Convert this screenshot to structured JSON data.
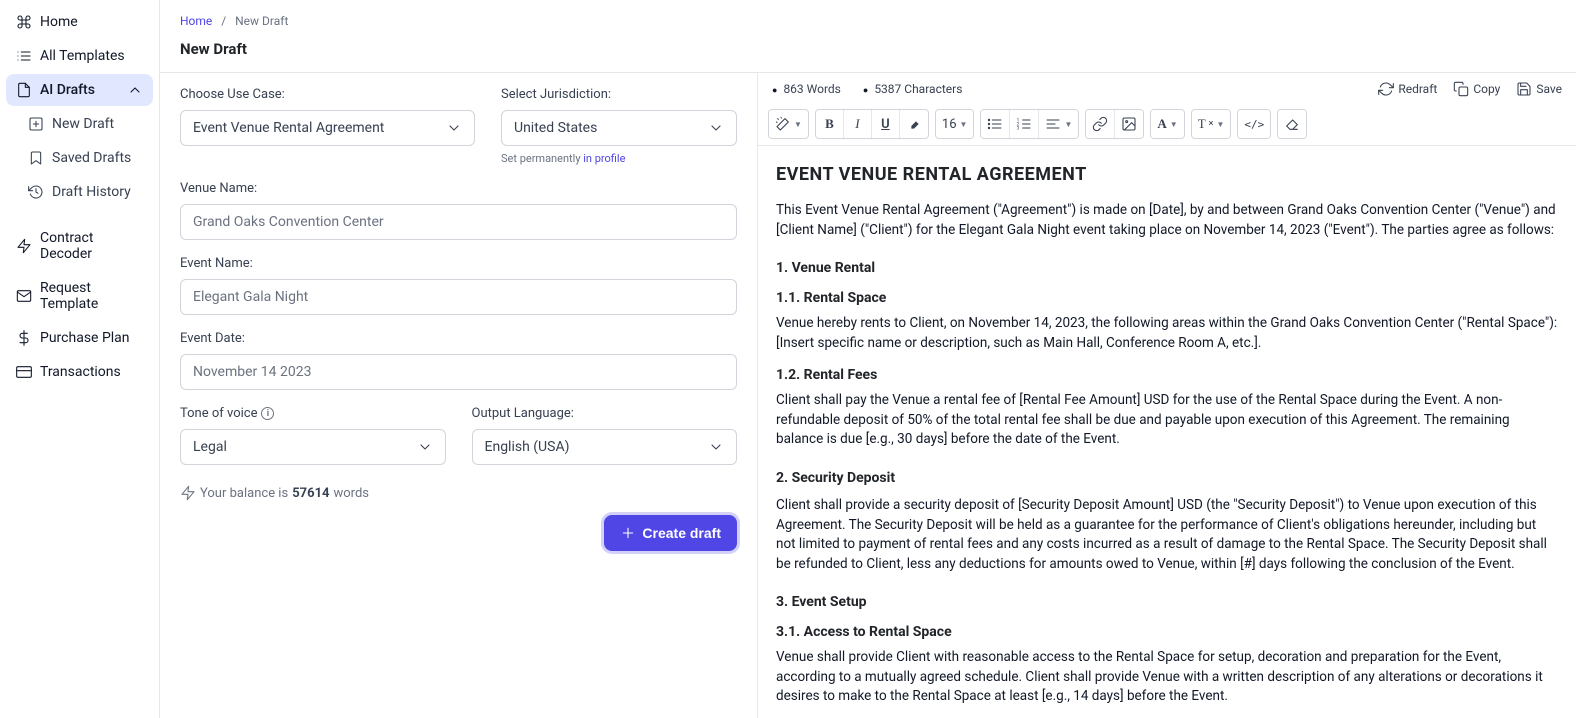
{
  "sidebar": {
    "home": "Home",
    "all_templates": "All Templates",
    "ai_drafts": "AI Drafts",
    "new_draft": "New Draft",
    "saved_drafts": "Saved Drafts",
    "draft_history": "Draft History",
    "contract_decoder": "Contract Decoder",
    "request_template": "Request Template",
    "purchase_plan": "Purchase Plan",
    "transactions": "Transactions"
  },
  "breadcrumb": {
    "home": "Home",
    "sep": "/",
    "current": "New Draft"
  },
  "page_title": "New Draft",
  "form": {
    "use_case_label": "Choose Use Case:",
    "use_case_value": "Event Venue Rental Agreement",
    "jurisdiction_label": "Select Jurisdiction:",
    "jurisdiction_value": "United States",
    "jurisdiction_hint_pre": "Set permanently ",
    "jurisdiction_hint_link": "in profile",
    "venue_label": "Venue Name:",
    "venue_value": "Grand Oaks Convention Center",
    "event_name_label": "Event Name:",
    "event_name_value": "Elegant Gala Night",
    "event_date_label": "Event Date:",
    "event_date_value": "November 14 2023",
    "tone_label": "Tone of voice",
    "tone_value": "Legal",
    "lang_label": "Output Language:",
    "lang_value": "English (USA)",
    "balance_pre": "Your balance is ",
    "balance_num": "57614",
    "balance_post": " words",
    "create_btn": "Create draft"
  },
  "stats": {
    "words": "863 Words",
    "chars": "5387 Characters",
    "redraft": "Redraft",
    "copy": "Copy",
    "save": "Save"
  },
  "toolbar": {
    "font_size": "16"
  },
  "doc": {
    "title": "EVENT VENUE RENTAL AGREEMENT",
    "intro": "This Event Venue Rental Agreement (\"Agreement\") is made on [Date], by and between Grand Oaks Convention Center (\"Venue\") and [Client Name] (\"Client\") for the Elegant Gala Night event taking place on November 14, 2023 (\"Event\"). The parties agree as follows:",
    "h_1": "1. Venue Rental",
    "h_1_1": "1.1. Rental Space",
    "p_1_1": "Venue hereby rents to Client, on November 14, 2023, the following areas within the Grand Oaks Convention Center (\"Rental Space\"): [Insert specific name or description, such as Main Hall, Conference Room A, etc.].",
    "h_1_2": "1.2. Rental Fees",
    "p_1_2": "Client shall pay the Venue a rental fee of [Rental Fee Amount] USD for the use of the Rental Space during the Event. A non-refundable deposit of 50% of the total rental fee shall be due and payable upon execution of this Agreement. The remaining balance is due [e.g., 30 days] before the date of the Event.",
    "h_2": "2. Security Deposit",
    "p_2": "Client shall provide a security deposit of [Security Deposit Amount] USD (the \"Security Deposit\") to Venue upon execution of this Agreement. The Security Deposit will be held as a guarantee for the performance of Client's obligations hereunder, including but not limited to payment of rental fees and any costs incurred as a result of damage to the Rental Space. The Security Deposit shall be refunded to Client, less any deductions for amounts owed to Venue, within [#] days following the conclusion of the Event.",
    "h_3": "3. Event Setup",
    "h_3_1": "3.1. Access to Rental Space",
    "p_3_1": "Venue shall provide Client with reasonable access to the Rental Space for setup, decoration and preparation for the Event, according to a mutually agreed schedule. Client shall provide Venue with a written description of any alterations or decorations it desires to make to the Rental Space at least [e.g., 14 days] before the Event."
  }
}
